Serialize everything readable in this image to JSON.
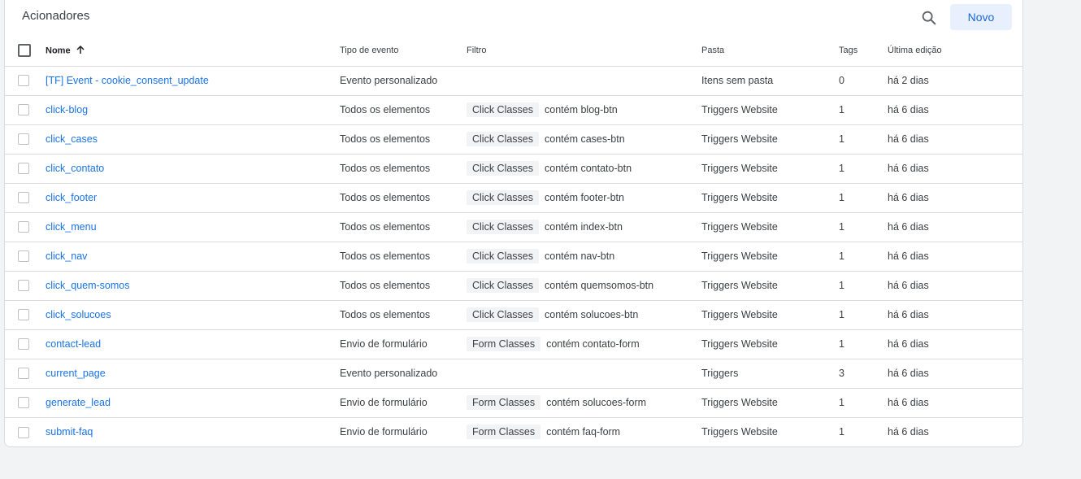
{
  "header": {
    "title": "Acionadores",
    "new_label": "Novo"
  },
  "columns": {
    "name": "Nome",
    "event_type": "Tipo de evento",
    "filter": "Filtro",
    "folder": "Pasta",
    "tags": "Tags",
    "last_edit": "Última edição"
  },
  "rows": [
    {
      "name": "[TF] Event - cookie_consent_update",
      "event_type": "Evento personalizado",
      "filter_var": "",
      "filter_cond": "",
      "folder": "Itens sem pasta",
      "tags": "0",
      "last_edit": "há 2 dias"
    },
    {
      "name": "click-blog",
      "event_type": "Todos os elementos",
      "filter_var": "Click Classes",
      "filter_cond": "contém blog-btn",
      "folder": "Triggers Website",
      "tags": "1",
      "last_edit": "há 6 dias"
    },
    {
      "name": "click_cases",
      "event_type": "Todos os elementos",
      "filter_var": "Click Classes",
      "filter_cond": "contém cases-btn",
      "folder": "Triggers Website",
      "tags": "1",
      "last_edit": "há 6 dias"
    },
    {
      "name": "click_contato",
      "event_type": "Todos os elementos",
      "filter_var": "Click Classes",
      "filter_cond": "contém contato-btn",
      "folder": "Triggers Website",
      "tags": "1",
      "last_edit": "há 6 dias"
    },
    {
      "name": "click_footer",
      "event_type": "Todos os elementos",
      "filter_var": "Click Classes",
      "filter_cond": "contém footer-btn",
      "folder": "Triggers Website",
      "tags": "1",
      "last_edit": "há 6 dias"
    },
    {
      "name": "click_menu",
      "event_type": "Todos os elementos",
      "filter_var": "Click Classes",
      "filter_cond": "contém index-btn",
      "folder": "Triggers Website",
      "tags": "1",
      "last_edit": "há 6 dias"
    },
    {
      "name": "click_nav",
      "event_type": "Todos os elementos",
      "filter_var": "Click Classes",
      "filter_cond": "contém nav-btn",
      "folder": "Triggers Website",
      "tags": "1",
      "last_edit": "há 6 dias"
    },
    {
      "name": "click_quem-somos",
      "event_type": "Todos os elementos",
      "filter_var": "Click Classes",
      "filter_cond": "contém quemsomos-btn",
      "folder": "Triggers Website",
      "tags": "1",
      "last_edit": "há 6 dias"
    },
    {
      "name": "click_solucoes",
      "event_type": "Todos os elementos",
      "filter_var": "Click Classes",
      "filter_cond": "contém solucoes-btn",
      "folder": "Triggers Website",
      "tags": "1",
      "last_edit": "há 6 dias"
    },
    {
      "name": "contact-lead",
      "event_type": "Envio de formulário",
      "filter_var": "Form Classes",
      "filter_cond": "contém contato-form",
      "folder": "Triggers Website",
      "tags": "1",
      "last_edit": "há 6 dias"
    },
    {
      "name": "current_page",
      "event_type": "Evento personalizado",
      "filter_var": "",
      "filter_cond": "",
      "folder": "Triggers",
      "tags": "3",
      "last_edit": "há 6 dias"
    },
    {
      "name": "generate_lead",
      "event_type": "Envio de formulário",
      "filter_var": "Form Classes",
      "filter_cond": "contém solucoes-form",
      "folder": "Triggers Website",
      "tags": "1",
      "last_edit": "há 6 dias"
    },
    {
      "name": "submit-faq",
      "event_type": "Envio de formulário",
      "filter_var": "Form Classes",
      "filter_cond": "contém faq-form",
      "folder": "Triggers Website",
      "tags": "1",
      "last_edit": "há 6 dias"
    }
  ],
  "icons": {
    "search": "search-icon",
    "sort": "arrow-up-icon"
  },
  "colors": {
    "link": "#1a73e8",
    "primary_button_bg": "#e8f0fe",
    "primary_button_text": "#1967d2",
    "chip_bg": "#f1f3f4"
  }
}
